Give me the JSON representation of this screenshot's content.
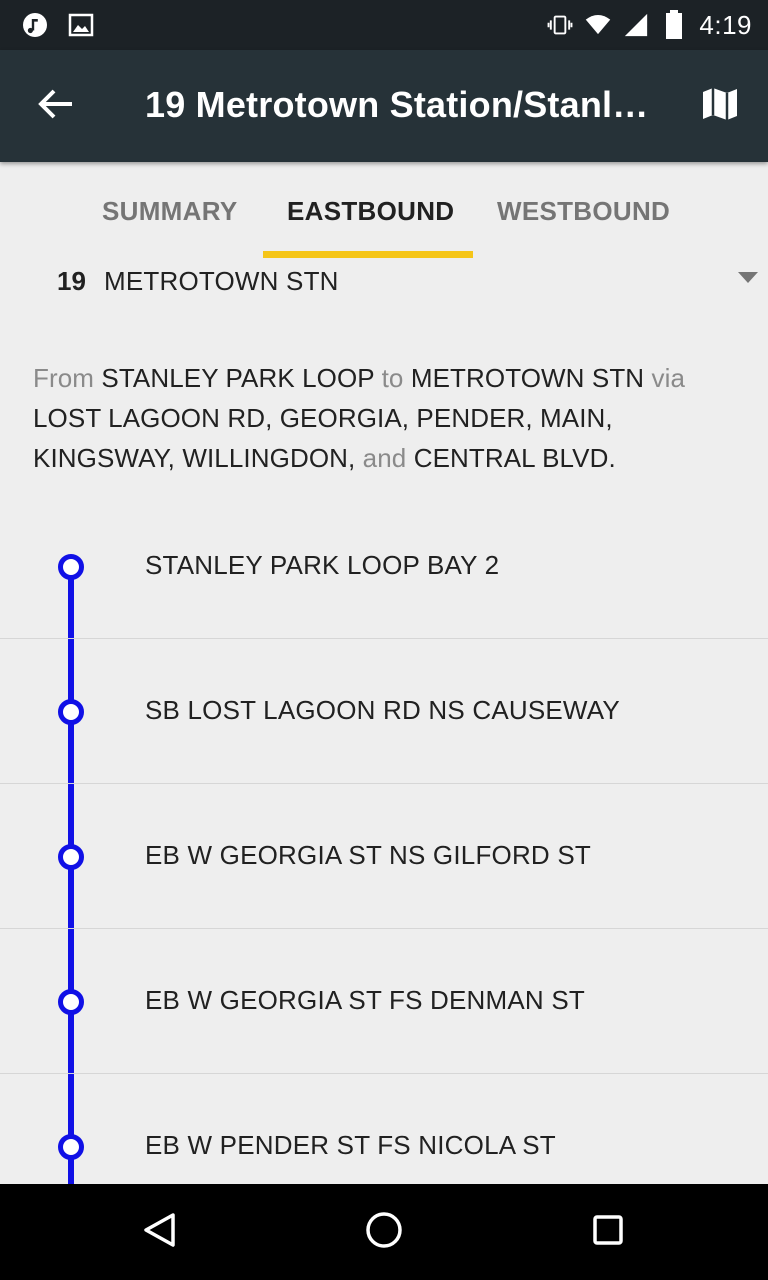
{
  "status_bar": {
    "time": "4:19",
    "left_icons": [
      "music-note-icon",
      "image-icon"
    ],
    "right_icons": [
      "vibrate-icon",
      "wifi-icon",
      "cell-signal-icon",
      "battery-icon"
    ]
  },
  "app_bar": {
    "title": "19 Metrotown Station/Stanley Park",
    "back_icon": "arrow-back-icon",
    "map_icon": "map-icon"
  },
  "tabs": [
    {
      "label": "SUMMARY",
      "active": false
    },
    {
      "label": "EASTBOUND",
      "active": true
    },
    {
      "label": "WESTBOUND",
      "active": false
    }
  ],
  "route_selector": {
    "number": "19",
    "name": "METROTOWN STN"
  },
  "description": {
    "from_word": "From",
    "from": "STANLEY PARK LOOP",
    "to_word": "to",
    "to": "METROTOWN STN",
    "via_word": "via",
    "via": "LOST LAGOON RD, GEORGIA, PENDER, MAIN, KINGSWAY, WILLINGDON,",
    "and_word": "and",
    "last": "CENTRAL BLVD."
  },
  "stops": [
    {
      "label": "STANLEY PARK LOOP BAY 2"
    },
    {
      "label": "SB LOST LAGOON RD NS CAUSEWAY"
    },
    {
      "label": "EB W GEORGIA ST NS GILFORD ST"
    },
    {
      "label": "EB W GEORGIA ST FS DENMAN ST"
    },
    {
      "label": "EB W PENDER ST FS NICOLA ST"
    }
  ],
  "colors": {
    "app_bar": "#263238",
    "status_bar": "#1c2226",
    "tab_indicator": "#f5c518",
    "route_line": "#1010e6",
    "background": "#eeeeee"
  },
  "nav_bar": {
    "icons": [
      "back-triangle-icon",
      "home-circle-icon",
      "recents-square-icon"
    ]
  }
}
